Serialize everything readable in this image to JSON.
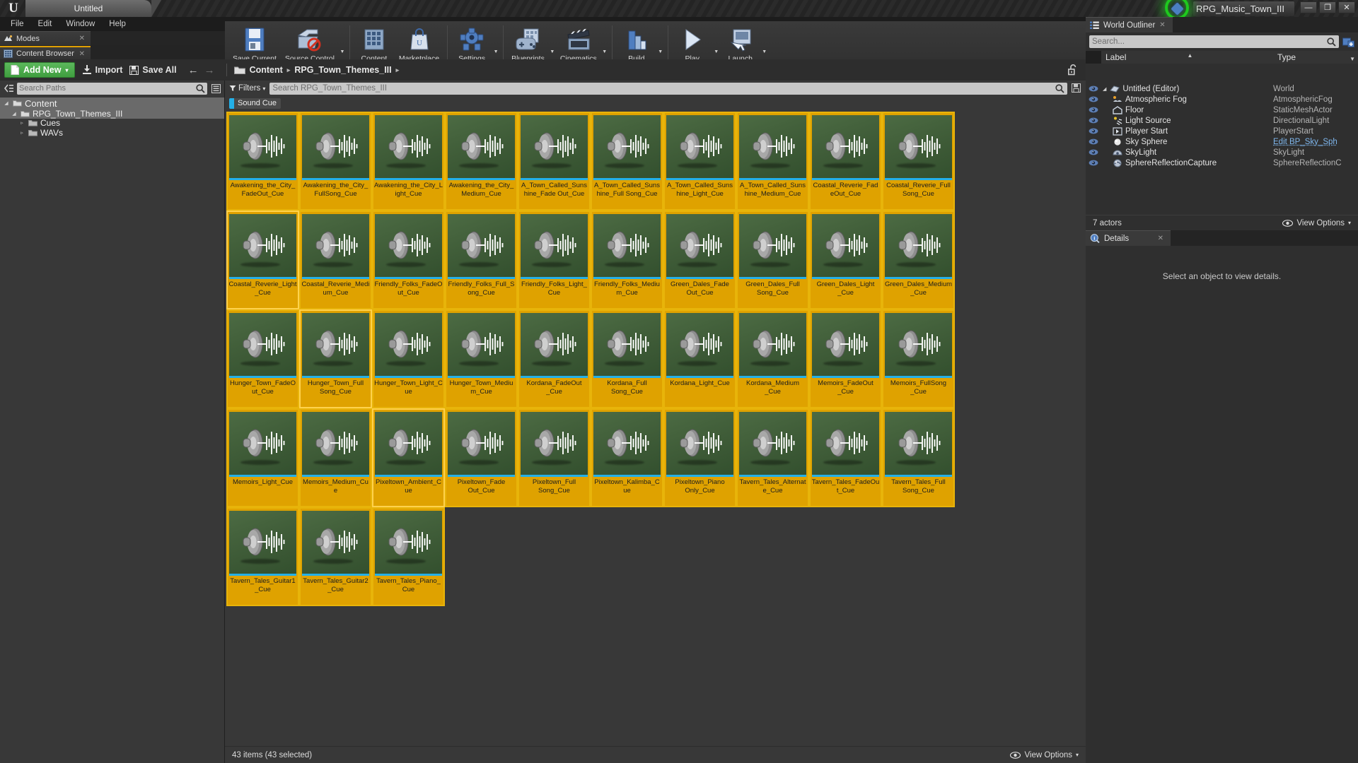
{
  "window": {
    "project_tab": "Untitled",
    "title": "RPG_Music_Town_III",
    "minimize": "—",
    "restore": "❐",
    "close": "✕"
  },
  "menu": {
    "items": [
      "File",
      "Edit",
      "Window",
      "Help"
    ]
  },
  "dock_tabs": [
    {
      "label": "Modes",
      "icon": "modes-icon",
      "close": "✕"
    },
    {
      "label": "Content Browser",
      "icon": "content-browser-icon",
      "close": "✕"
    }
  ],
  "toolbar": {
    "groups": [
      {
        "buttons": [
          {
            "label": "Save Current",
            "icon": "floppy-disk-icon",
            "caret": false
          },
          {
            "label": "Source Control",
            "icon": "source-control-icon",
            "caret": true
          }
        ]
      },
      {
        "buttons": [
          {
            "label": "Content",
            "icon": "content-icon",
            "caret": false
          },
          {
            "label": "Marketplace",
            "icon": "marketplace-icon",
            "caret": false
          }
        ]
      },
      {
        "buttons": [
          {
            "label": "Settings",
            "icon": "gear-icon",
            "caret": true
          }
        ]
      },
      {
        "buttons": [
          {
            "label": "Blueprints",
            "icon": "blueprints-icon",
            "caret": true
          },
          {
            "label": "Cinematics",
            "icon": "clapperboard-icon",
            "caret": true
          }
        ]
      },
      {
        "buttons": [
          {
            "label": "Build",
            "icon": "build-icon",
            "caret": true
          }
        ]
      },
      {
        "buttons": [
          {
            "label": "Play",
            "icon": "play-icon",
            "caret": true
          },
          {
            "label": "Launch",
            "icon": "launch-icon",
            "caret": true
          }
        ]
      }
    ]
  },
  "content_browser": {
    "add_new_label": "Add New",
    "add_new_caret": "▾",
    "import_label": "Import",
    "save_all_label": "Save All",
    "back_arrow": "←",
    "forward_arrow": "→",
    "breadcrumb": [
      "Content",
      "RPG_Town_Themes_III"
    ],
    "breadcrumb_sep": "▸",
    "lock_icon": "unlocked-padlock-icon",
    "paths": {
      "search_placeholder": "Search Paths",
      "search_value": "",
      "tree": [
        {
          "label": "Content",
          "depth": 0,
          "arrow": "◢",
          "selected": true,
          "expanded": true
        },
        {
          "label": "RPG_Town_Themes_III",
          "depth": 1,
          "arrow": "◢",
          "selected": true,
          "expanded": true
        },
        {
          "label": "Cues",
          "depth": 2,
          "arrow": "▹",
          "selected": false,
          "expanded": false
        },
        {
          "label": "WAVs",
          "depth": 2,
          "arrow": "▹",
          "selected": false,
          "expanded": false
        }
      ]
    },
    "filters_label": "Filters",
    "filters_caret": "▾",
    "asset_search_placeholder": "Search RPG_Town_Themes_III",
    "asset_search_value": "",
    "active_filter_chip": "Sound Cue",
    "chip_color": "#24b0e8",
    "status_text": "43 items (43 selected)",
    "view_options_label": "View Options",
    "view_options_caret": "▾",
    "assets": [
      "Awakening_the_City_FadeOut_Cue",
      "Awakening_the_City_FullSong_Cue",
      "Awakening_the_City_Light_Cue",
      "Awakening_the_City_Medium_Cue",
      "A_Town_Called_Sunshine_Fade Out_Cue",
      "A_Town_Called_Sunshine_Full Song_Cue",
      "A_Town_Called_Sunshine_Light_Cue",
      "A_Town_Called_Sunshine_Medium_Cue",
      "Coastal_Reverie_FadeOut_Cue",
      "Coastal_Reverie_FullSong_Cue",
      "Coastal_Reverie_Light_Cue",
      "Coastal_Reverie_Medium_Cue",
      "Friendly_Folks_FadeOut_Cue",
      "Friendly_Folks_Full_Song_Cue",
      "Friendly_Folks_Light_Cue",
      "Friendly_Folks_Medium_Cue",
      "Green_Dales_Fade Out_Cue",
      "Green_Dales_Full Song_Cue",
      "Green_Dales_Light _Cue",
      "Green_Dales_Medium_Cue",
      "Hunger_Town_FadeOut_Cue",
      "Hunger_Town_Full Song_Cue",
      "Hunger_Town_Light_Cue",
      "Hunger_Town_Medium_Cue",
      "Kordana_FadeOut _Cue",
      "Kordana_Full Song_Cue",
      "Kordana_Light_Cue",
      "Kordana_Medium _Cue",
      "Memoirs_FadeOut _Cue",
      "Memoirs_FullSong _Cue",
      "Memoirs_Light_Cue",
      "Memoirs_Medium_Cue",
      "Pixeltown_Ambient_Cue",
      "Pixeltown_Fade Out_Cue",
      "Pixeltown_Full Song_Cue",
      "Pixeltown_Kalimba_Cue",
      "Pixeltown_Piano Only_Cue",
      "Tavern_Tales_Alternate_Cue",
      "Tavern_Tales_FadeOut_Cue",
      "Tavern_Tales_Full Song_Cue",
      "Tavern_Tales_Guitar1_Cue",
      "Tavern_Tales_Guitar2_Cue",
      "Tavern_Tales_Piano_Cue"
    ]
  },
  "world_outliner": {
    "tab_label": "World Outliner",
    "tab_close": "✕",
    "search_placeholder": "Search...",
    "search_value": "",
    "add_button_icon": "add-actor-icon",
    "columns": {
      "label": "Label",
      "type": "Type"
    },
    "rows": [
      {
        "label": "Untitled (Editor)",
        "type": "World",
        "depth": 0,
        "icon": "world-icon",
        "type_is_link": false
      },
      {
        "label": "Atmospheric Fog",
        "type": "AtmosphericFog",
        "depth": 1,
        "icon": "fog-icon",
        "type_is_link": false
      },
      {
        "label": "Floor",
        "type": "StaticMeshActor",
        "depth": 1,
        "icon": "mesh-icon",
        "type_is_link": false
      },
      {
        "label": "Light Source",
        "type": "DirectionalLight",
        "depth": 1,
        "icon": "light-icon",
        "type_is_link": false
      },
      {
        "label": "Player Start",
        "type": "PlayerStart",
        "depth": 1,
        "icon": "player-start-icon",
        "type_is_link": false
      },
      {
        "label": "Sky Sphere",
        "type": "Edit BP_Sky_Sph",
        "depth": 1,
        "icon": "sphere-icon",
        "type_is_link": true
      },
      {
        "label": "SkyLight",
        "type": "SkyLight",
        "depth": 1,
        "icon": "skylight-icon",
        "type_is_link": false
      },
      {
        "label": "SphereReflectionCapture",
        "type": "SphereReflectionC",
        "depth": 1,
        "icon": "reflection-capture-icon",
        "type_is_link": false
      }
    ],
    "footer_count": "7 actors",
    "view_options_label": "View Options",
    "view_options_caret": "▾"
  },
  "details": {
    "tab_label": "Details",
    "tab_close": "✕",
    "empty_message": "Select an object to view details."
  }
}
